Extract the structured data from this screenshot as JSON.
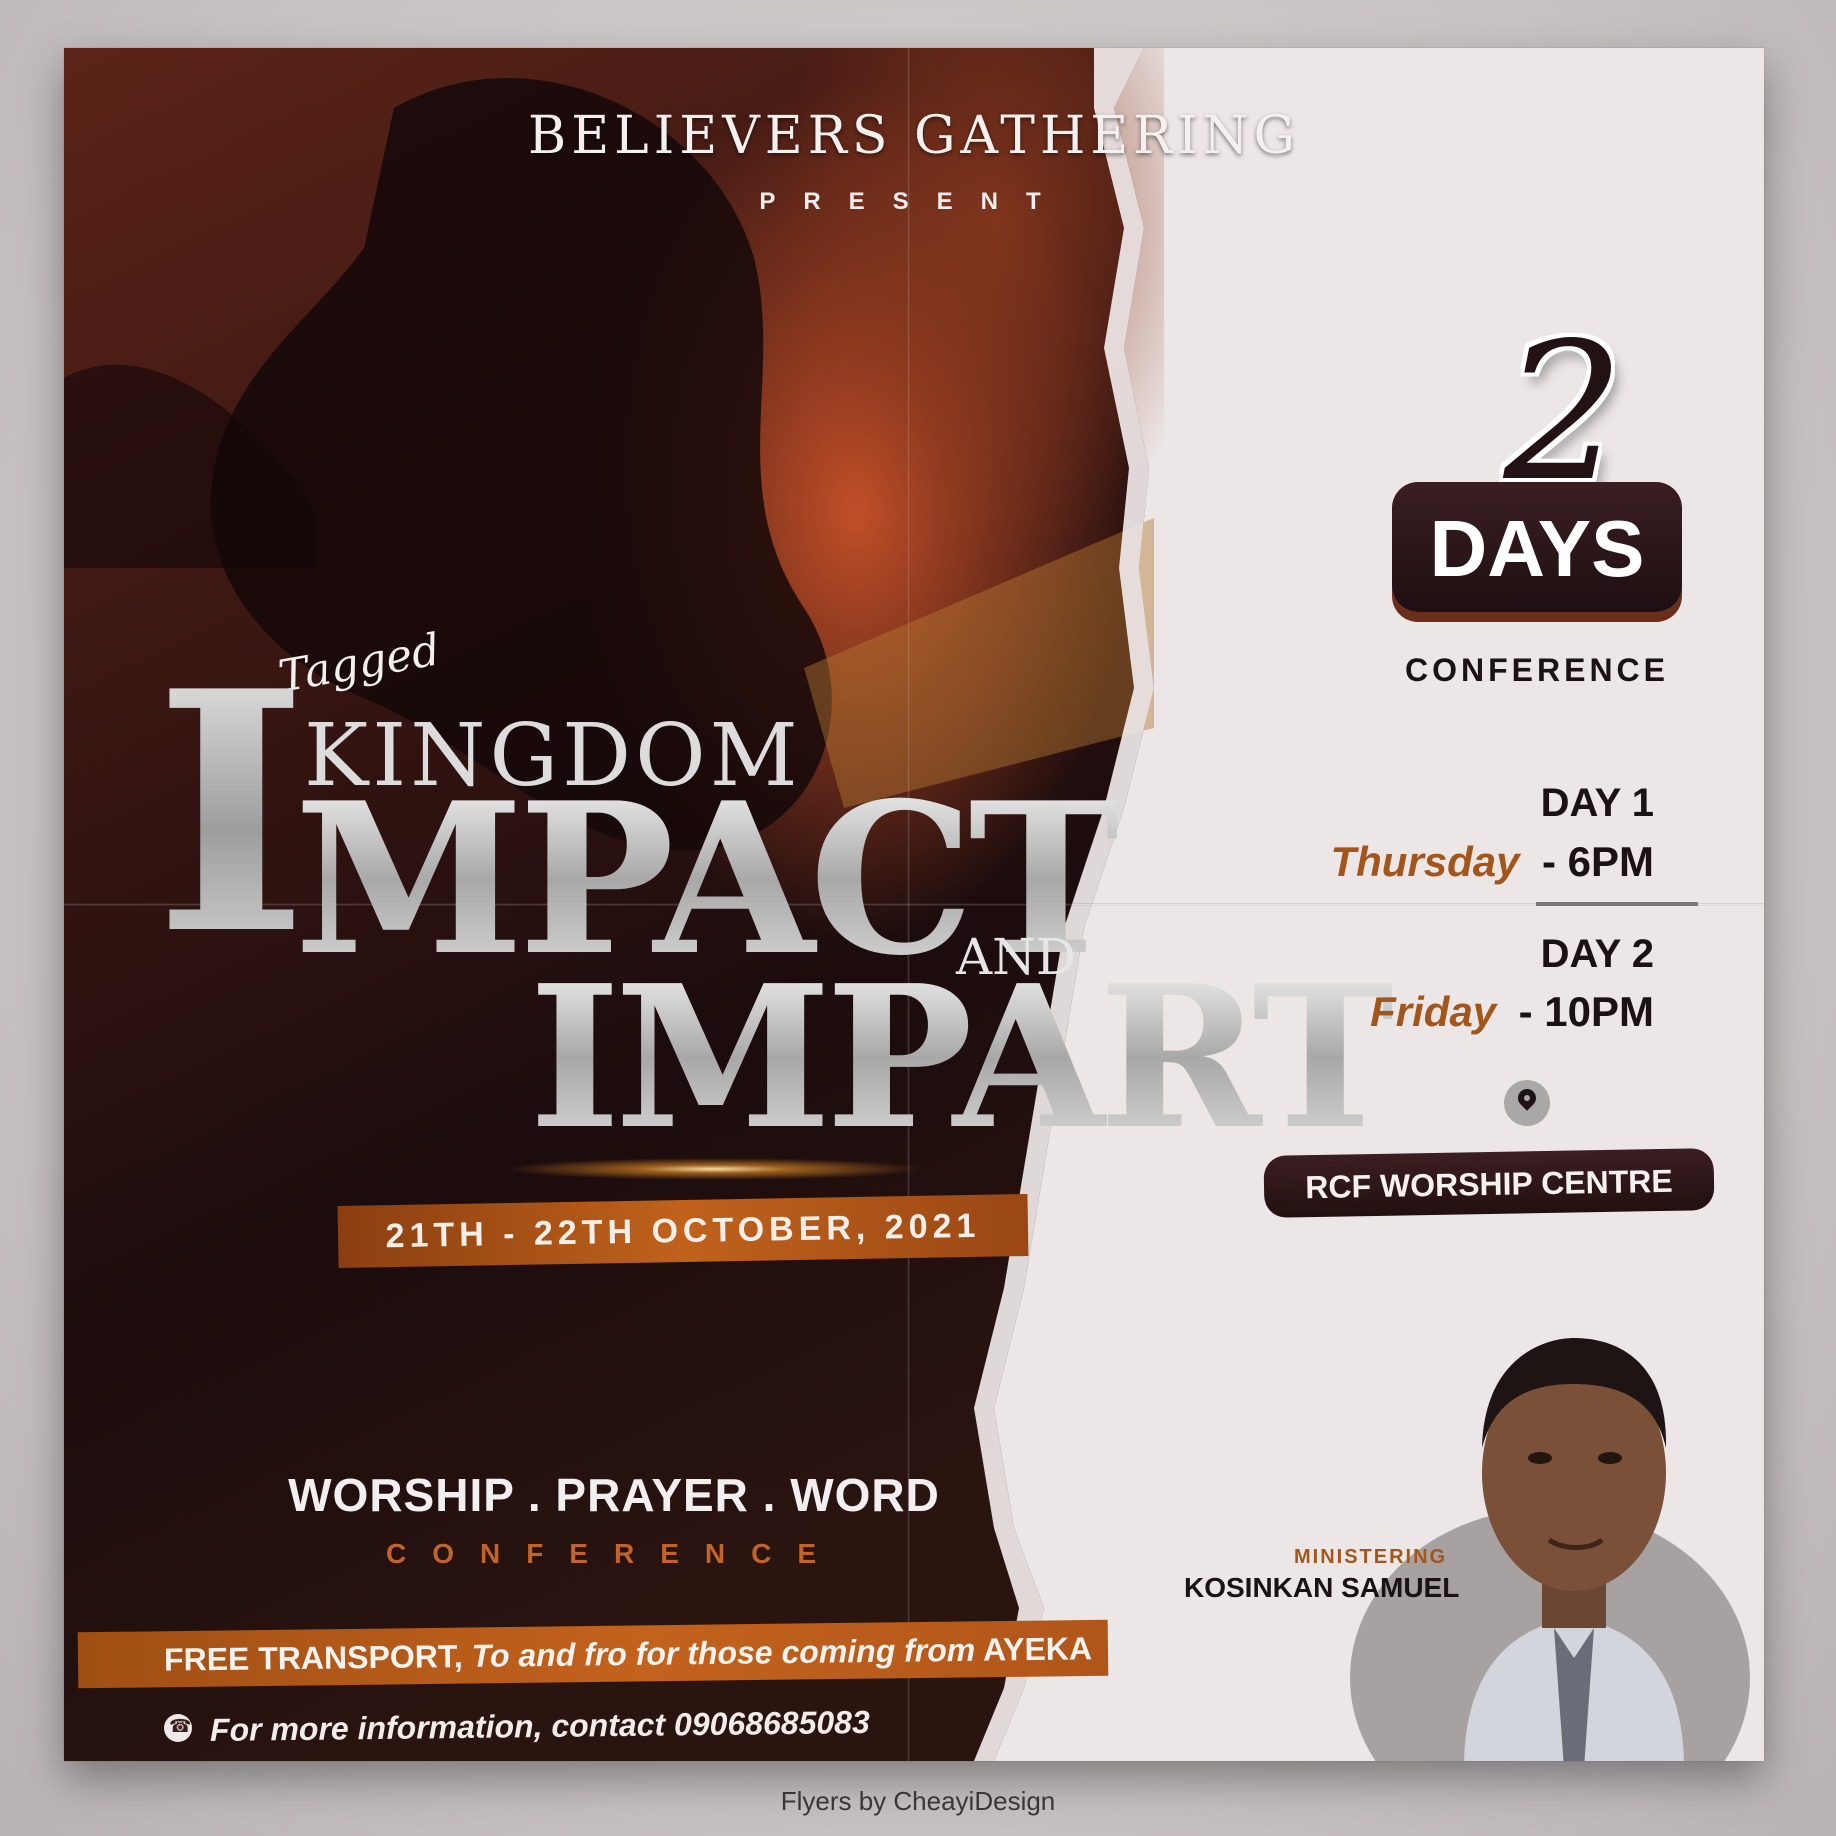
{
  "colors": {
    "dark_bg": "#1f0f12",
    "accent_orange": "#c3621d",
    "paper": "#ece6e6",
    "text_dark": "#1a1213"
  },
  "header": {
    "organizer": "BELIEVERS GATHERING",
    "present": "PRESENT"
  },
  "title": {
    "tagged": "Tagged",
    "kingdom": "KINGDOM",
    "impact_first": "I",
    "impact_rest": "MPACT",
    "and": "AND",
    "impart": "IMPART"
  },
  "date": "21TH - 22TH OCTOBER, 2021",
  "pillars": "WORSHIP . PRAYER . WORD",
  "conference_left": "CONFERENCE",
  "transport": {
    "strong": "FREE TRANSPORT,",
    "detail": "To and fro for those coming from",
    "place": "AYEKA"
  },
  "contact": {
    "icon": "phone-icon",
    "text": "For more information, contact 09068685083"
  },
  "duration": {
    "number": "2",
    "unit": "DAYS",
    "label": "CONFERENCE"
  },
  "schedule": [
    {
      "label": "DAY 1",
      "day": "Thursday",
      "time": "- 6PM"
    },
    {
      "label": "DAY 2",
      "day": "Friday",
      "time": "- 10PM"
    }
  ],
  "venue": {
    "icon": "location-pin-icon",
    "name": "RCF WORSHIP CENTRE"
  },
  "minister": {
    "role": "MINISTERING",
    "name": "KOSINKAN SAMUEL"
  },
  "credit": "Flyers  by CheayiDesign"
}
